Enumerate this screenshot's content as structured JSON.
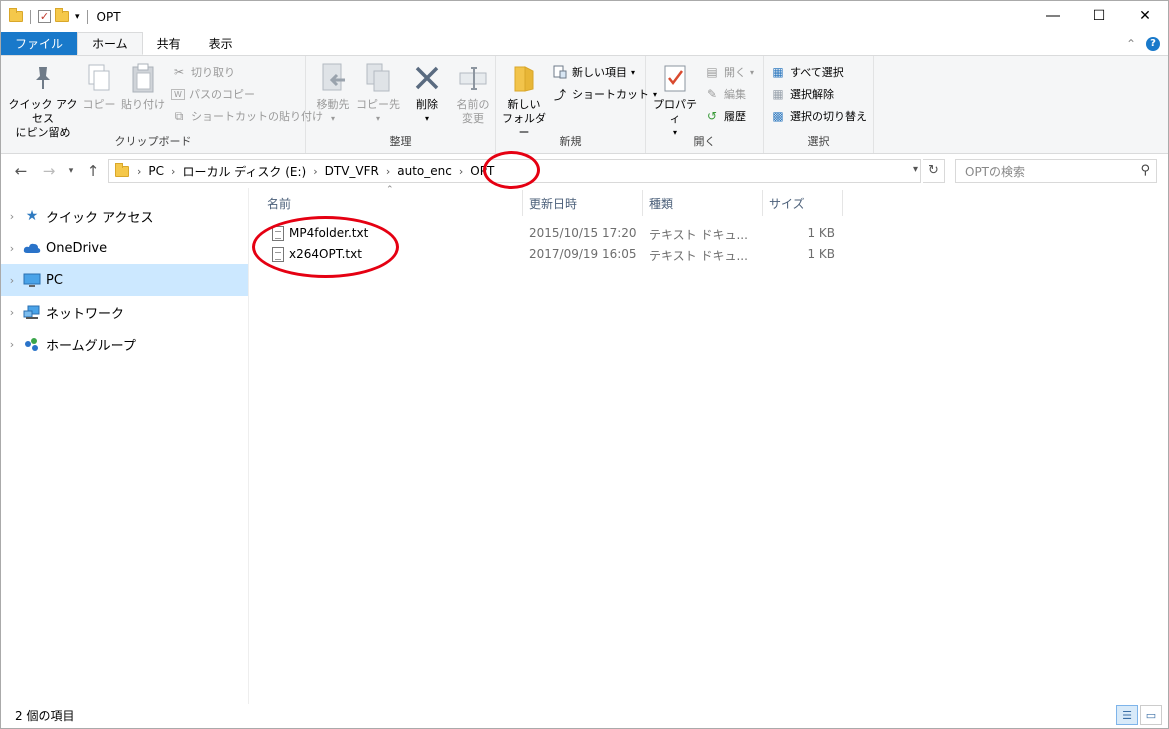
{
  "window": {
    "title": "OPT"
  },
  "ribbon_tabs": [
    "ファイル",
    "ホーム",
    "共有",
    "表示"
  ],
  "ribbon": {
    "clipboard": {
      "label": "クリップボード",
      "pin": "クイック アクセス\nにピン留め",
      "copy": "コピー",
      "paste": "貼り付け",
      "cut": "切り取り",
      "copy_path": "パスのコピー",
      "paste_shortcut": "ショートカットの貼り付け"
    },
    "organize": {
      "label": "整理",
      "move_to": "移動先",
      "copy_to": "コピー先",
      "delete": "削除",
      "rename": "名前の\n変更"
    },
    "new": {
      "label": "新規",
      "new_folder": "新しい\nフォルダー",
      "new_item": "新しい項目",
      "shortcut": "ショートカット"
    },
    "open": {
      "label": "開く",
      "properties": "プロパティ",
      "open": "開く",
      "edit": "編集",
      "history": "履歴"
    },
    "select": {
      "label": "選択",
      "select_all": "すべて選択",
      "select_none": "選択解除",
      "invert": "選択の切り替え"
    }
  },
  "address": {
    "crumbs": [
      "PC",
      "ローカル ディスク (E:)",
      "DTV_VFR",
      "auto_enc",
      "OPT"
    ]
  },
  "search": {
    "placeholder": "OPTの検索"
  },
  "nav": [
    {
      "label": "クイック アクセス",
      "icon": "star-icon"
    },
    {
      "label": "OneDrive",
      "icon": "cloud-icon"
    },
    {
      "label": "PC",
      "icon": "monitor-icon",
      "selected": true
    },
    {
      "label": "ネットワーク",
      "icon": "network-icon"
    },
    {
      "label": "ホームグループ",
      "icon": "homegroup-icon"
    }
  ],
  "columns": {
    "name": "名前",
    "modified": "更新日時",
    "type": "種類",
    "size": "サイズ"
  },
  "files": [
    {
      "name": "MP4folder.txt",
      "modified": "2015/10/15 17:20",
      "type": "テキスト ドキュ...",
      "size": "1 KB"
    },
    {
      "name": "x264OPT.txt",
      "modified": "2017/09/19 16:05",
      "type": "テキスト ドキュ...",
      "size": "1 KB"
    }
  ],
  "status": {
    "count": "2 個の項目"
  },
  "colors": {
    "accent": "#1979ca",
    "selected_bg": "#cce8ff",
    "annotation": "#e50012"
  }
}
